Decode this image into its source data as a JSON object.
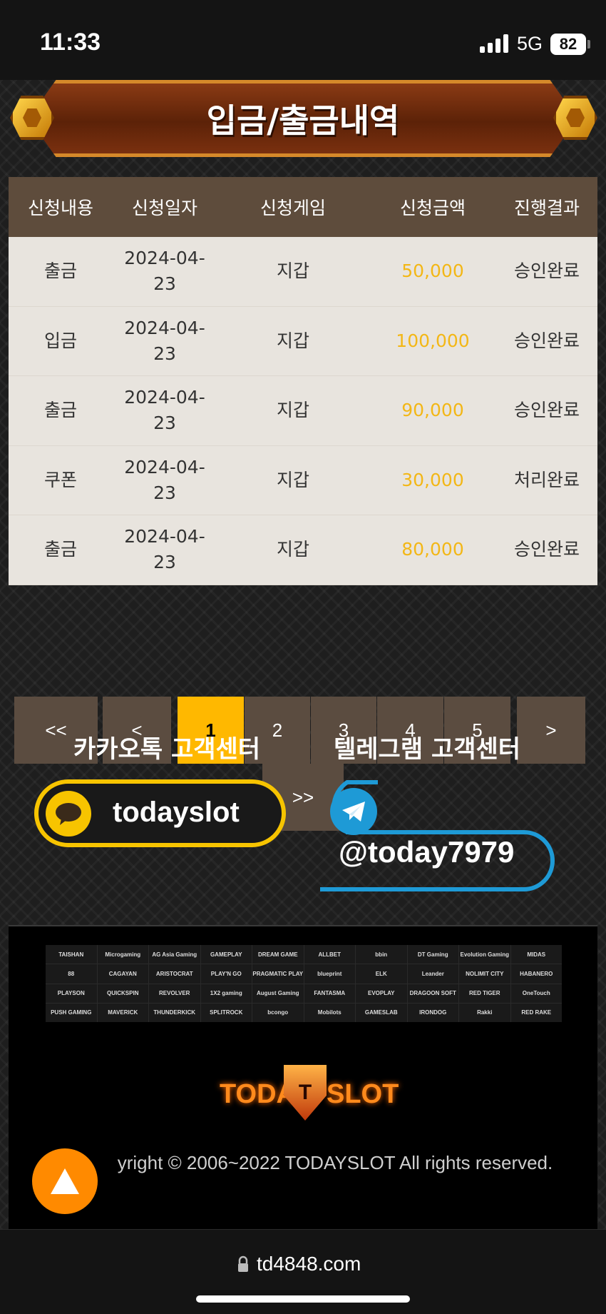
{
  "status_bar": {
    "time": "11:33",
    "network": "5G",
    "battery": "82"
  },
  "page": {
    "title": "입금/출금내역"
  },
  "table": {
    "headers": [
      "신청내용",
      "신청일자",
      "신청게임",
      "신청금액",
      "진행결과"
    ],
    "rows": [
      {
        "type": "출금",
        "date": "2024-04-23",
        "game": "지갑",
        "amount": "50,000",
        "result": "승인완료"
      },
      {
        "type": "입금",
        "date": "2024-04-23",
        "game": "지갑",
        "amount": "100,000",
        "result": "승인완료"
      },
      {
        "type": "출금",
        "date": "2024-04-23",
        "game": "지갑",
        "amount": "90,000",
        "result": "승인완료"
      },
      {
        "type": "쿠폰",
        "date": "2024-04-23",
        "game": "지갑",
        "amount": "30,000",
        "result": "처리완료"
      },
      {
        "type": "출금",
        "date": "2024-04-23",
        "game": "지갑",
        "amount": "80,000",
        "result": "승인완료"
      }
    ]
  },
  "pagination": {
    "first": "<<",
    "prev": "<",
    "pages": [
      "1",
      "2",
      "3",
      "4",
      "5"
    ],
    "current": "1",
    "next": ">",
    "last": ">>"
  },
  "support": {
    "kakao_label": "카카오톡 고객센터",
    "kakao_id": "todayslot",
    "telegram_label": "텔레그램 고객센터",
    "telegram_id": "@today7979"
  },
  "providers": [
    "TAISHAN",
    "Microgaming",
    "AG Asia Gaming",
    "GAMEPLAY",
    "DREAM GAME",
    "ALLBET",
    "bbin",
    "DT Gaming",
    "Evolution Gaming",
    "MIDAS",
    "88",
    "CAGAYAN",
    "ARISTOCRAT",
    "PLAY'N GO",
    "PRAGMATIC PLAY",
    "blueprint",
    "ELK",
    "Leander",
    "NOLIMIT CITY",
    "HABANERO",
    "PLAYSON",
    "QUICKSPIN",
    "REVOLVER",
    "1X2 gaming",
    "August Gaming",
    "FANTASMA",
    "EVOPLAY",
    "DRAGOON SOFT",
    "RED TIGER",
    "OneTouch",
    "PUSH GAMING",
    "MAVERICK",
    "THUNDERKICK",
    "SPLITROCK",
    "bcongo",
    "Mobilots",
    "GAMESLAB",
    "IRONDOG",
    "Rakki",
    "RED RAKE"
  ],
  "brand": {
    "left": "TODAY",
    "right": "SLOT",
    "badge": "T"
  },
  "footer": {
    "copyright": "yright © 2006~2022 TODAYSLOT All rights reserved."
  },
  "browser": {
    "url": "td4848.com"
  },
  "colors": {
    "accent": "#ffb800",
    "amount": "#f3b716",
    "kakao": "#f7c400",
    "telegram": "#1e9ad6",
    "top_button": "#ff8a00"
  }
}
